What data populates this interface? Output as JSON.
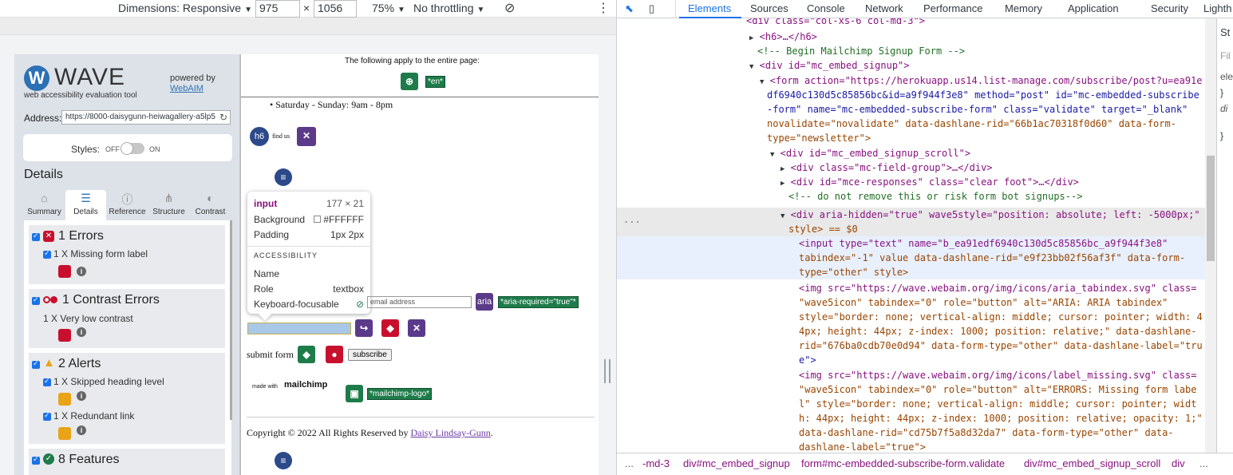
{
  "device_toolbar": {
    "dimensions_label": "Dimensions: Responsive",
    "width": "975",
    "times": "×",
    "height": "1056",
    "zoom": "75%",
    "throttling": "No throttling"
  },
  "wave": {
    "logo_w": "W",
    "logo_text": "WAVE",
    "subtitle": "web accessibility evaluation tool",
    "powered_by": "powered by",
    "webaim": "WebAIM",
    "address_label": "Address:",
    "address_value": "https://8000-daisygunn-heiwagallery-a5lp5",
    "styles_label": "Styles:",
    "styles_off": "OFF",
    "styles_on": "ON",
    "details_title": "Details",
    "tabs": [
      {
        "label": "Summary",
        "icon": "home-icon"
      },
      {
        "label": "Details",
        "icon": "list-icon"
      },
      {
        "label": "Reference",
        "icon": "info-icon"
      },
      {
        "label": "Structure",
        "icon": "structure-icon"
      },
      {
        "label": "Contrast",
        "icon": "contrast-icon"
      }
    ],
    "sections": [
      {
        "title": "1 Errors",
        "line": "1 X Missing form label"
      },
      {
        "title": "1 Contrast Errors",
        "line": "1 X Very low contrast"
      },
      {
        "title": "2 Alerts",
        "line1": "1 X Skipped heading level",
        "line2": "1 X Redundant link"
      },
      {
        "title": "8 Features"
      }
    ]
  },
  "page": {
    "apply_text": "The following apply to the entire page:",
    "lang_tag": "*en*",
    "hours": "Saturday - Sunday: 9am - 8pm",
    "h6_label": "h6",
    "find_us": "find us",
    "aria_label": "aria",
    "aria_required_tag": "*aria-required=\"true\"*",
    "email_placeholder": "email address",
    "submit_form": "submit form",
    "subscribe": "subscribe",
    "made_with": "made with",
    "mailchimp": "mailchimp",
    "mailchimp_logo_tag": "*mailchimp-logo*",
    "copyright_prefix": "Copyright © 2022 All Rights Reserved by",
    "copyright_link": "Daisy Lindsay-Gunn",
    "copyright_suffix": "."
  },
  "tooltip": {
    "element": "input",
    "size": "177 × 21",
    "background_label": "Background",
    "background_value": "#FFFFFF",
    "padding_label": "Padding",
    "padding_value": "1px 2px",
    "accessibility_label": "ACCESSIBILITY",
    "name_label": "Name",
    "role_label": "Role",
    "role_value": "textbox",
    "keyboard_label": "Keyboard-focusable"
  },
  "devtools": {
    "tabs": [
      "Elements",
      "Sources",
      "Console",
      "Network",
      "Performance",
      "Memory",
      "Application",
      "Security",
      "Lighth"
    ],
    "code_lines": [
      "<div class=\"col-xs-6 col-md-3\">",
      "<h6>…</h6>",
      "<!-- Begin Mailchimp Signup Form -->",
      "<div id=\"mc_embed_signup\">",
      "<form action=\"https://herokuapp.us14.list-manage.com/subscribe/post?u=ea91e",
      "df6940c130d5c85856bc&id=a9f944f3e8\" method=\"post\" id=\"mc-embedded-subscribe",
      "-form\" name=\"mc-embedded-subscribe-form\" class=\"validate\" target=\"_blank\"",
      "novalidate=\"novalidate\" data-dashlane-rid=\"66b1ac70318f0d60\" data-form-",
      "type=\"newsletter\">",
      "<div id=\"mc_embed_signup_scroll\">",
      "<div class=\"mc-field-group\">…</div>",
      "<div id=\"mce-responses\" class=\"clear foot\">…</div>",
      "<!--  do not remove this or risk form bot signups-->",
      "<div aria-hidden=\"true\" wave5style=\"position: absolute; left: -5000px;\"",
      "style> == $0",
      "<input type=\"text\" name=\"b_ea91edf6940c130d5c85856bc_a9f944f3e8\"",
      "tabindex=\"-1\" value data-dashlane-rid=\"e9f23bb02f56af3f\" data-form-",
      "type=\"other\" style>",
      "<img src=\"https://wave.webaim.org/img/icons/aria_tabindex.svg\" class=",
      "\"wave5icon\" tabindex=\"0\" role=\"button\" alt=\"ARIA: ARIA tabindex\"",
      "style=\"border: none; vertical-align: middle; cursor: pointer; width: 4",
      "4px; height: 44px; z-index: 1000; position: relative;\" data-dashlane-",
      "rid=\"676ba0cdb70e0d94\" data-form-type=\"other\" data-dashlane-label=\"tru",
      "e\">",
      "<img src=\"https://wave.webaim.org/img/icons/label_missing.svg\" class=",
      "\"wave5icon\" tabindex=\"0\" role=\"button\" alt=\"ERRORS: Missing form labe",
      "l\" style=\"border: none; vertical-align: middle; cursor: pointer; widt",
      "h: 44px; height: 44px; z-index: 1000; position: relative; opacity: 1;\"",
      "data-dashlane-rid=\"cd75b7f5a8d32da7\" data-form-type=\"other\" data-",
      "dashlane-label=\"true\">"
    ],
    "ellipsis": "...",
    "breadcrumbs": [
      "...",
      "-md-3",
      "div#mc_embed_signup",
      "form#mc-embedded-subscribe-form.validate",
      "div#mc_embed_signup_scroll",
      "div",
      "..."
    ],
    "styles_pane": [
      "St",
      "Fil",
      "ele",
      "}",
      "di",
      "}"
    ]
  }
}
